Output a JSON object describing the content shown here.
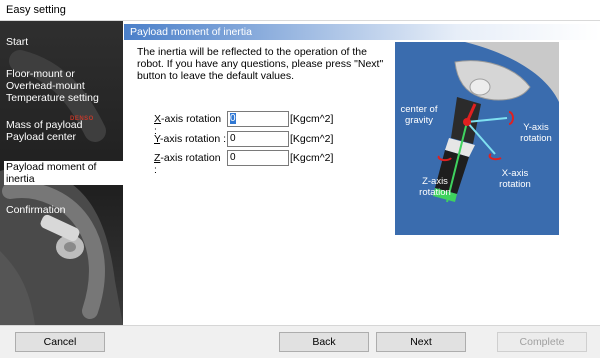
{
  "window": {
    "title": "Easy setting"
  },
  "sidebar": {
    "items": [
      {
        "label": "Start"
      },
      {
        "label": "Floor-mount or Overhead-mount Temperature setting"
      },
      {
        "label": "Mass of payload Payload center"
      },
      {
        "label": "Payload moment of inertia",
        "active": true
      },
      {
        "label": "Confirmation"
      }
    ],
    "brand_text": "DENSO"
  },
  "section": {
    "title": "Payload moment of inertia",
    "description": "The inertia will be reflected to the operation of the robot. If you have any questions, please press \"Next\" button to leave the default values."
  },
  "fields": [
    {
      "accel": "X",
      "label_rest": "-axis rotation :",
      "value": "0",
      "unit": "[Kgcm^2]",
      "focused": true
    },
    {
      "accel": "Y",
      "label_rest": "-axis rotation :",
      "value": "0",
      "unit": "[Kgcm^2]",
      "focused": false
    },
    {
      "accel": "Z",
      "label_rest": "-axis rotation :",
      "value": "0",
      "unit": "[Kgcm^2]",
      "focused": false
    }
  ],
  "diagram": {
    "center_of_gravity": "center of gravity",
    "y_axis": "Y-axis rotation",
    "x_axis": "X-axis rotation",
    "z_axis": "Z-axis rotation"
  },
  "buttons": {
    "cancel": "Cancel",
    "back": "Back",
    "next": "Next",
    "complete": "Complete"
  },
  "colors": {
    "header_blue": "#4a7fc9",
    "diagram_bg": "#3a6cae",
    "axis_red": "#e02020",
    "axis_cyan": "#7fe0f0",
    "axis_green": "#3fd25f"
  }
}
